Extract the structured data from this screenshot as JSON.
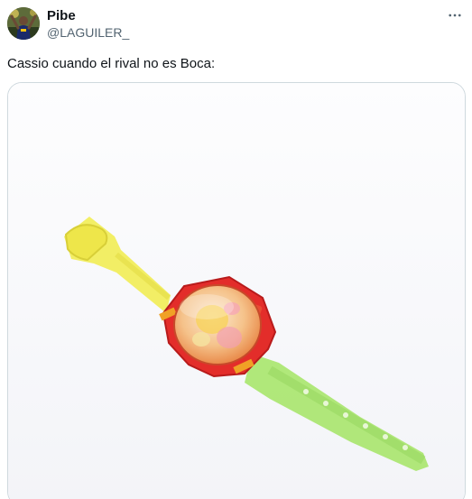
{
  "author": {
    "display_name": "Pibe",
    "handle": "@LAGUILER_"
  },
  "tweet": {
    "text": "Cassio cuando el rival no es Boca:"
  },
  "icons": {
    "more": "more-horizontal-icon"
  },
  "colors": {
    "text_primary": "#0f1419",
    "text_secondary": "#536471",
    "border": "#cfd9de"
  }
}
